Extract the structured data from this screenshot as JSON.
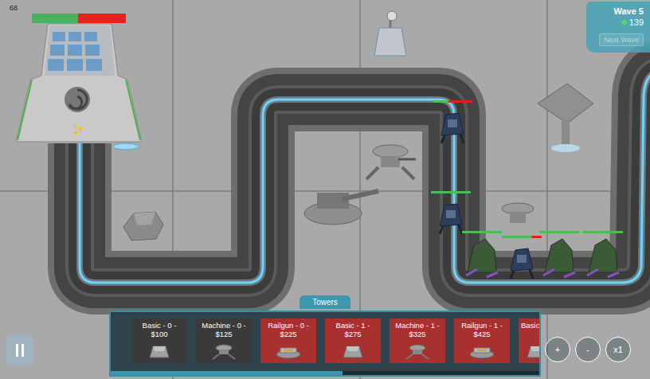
{
  "fps": "68",
  "base": {
    "health": 0.49
  },
  "wave_panel": {
    "wave": "Wave 5",
    "money": "139",
    "next_wave_button": {
      "label": "Next Wave",
      "disabled": true
    }
  },
  "enemies": [
    {
      "kind": "drone",
      "health": 0.4
    },
    {
      "kind": "drone",
      "health": 1.0
    },
    {
      "kind": "brute",
      "health": 1.0
    },
    {
      "kind": "drone",
      "health": 0.75
    },
    {
      "kind": "brute",
      "health": 1.0
    },
    {
      "kind": "brute",
      "health": 1.0
    }
  ],
  "tower_tray": {
    "tab": "Towers",
    "towers": [
      {
        "label": "Basic - 0 - $100",
        "kind": "basic",
        "affordable": true
      },
      {
        "label": "Machine - 0 - $125",
        "kind": "machine",
        "affordable": true
      },
      {
        "label": "Railgun - 0 - $225",
        "kind": "railgun",
        "affordable": false
      },
      {
        "label": "Basic - 1 - $275",
        "kind": "basic",
        "affordable": false
      },
      {
        "label": "Machine - 1 - $325",
        "kind": "machine",
        "affordable": false
      },
      {
        "label": "Railgun - 1 - $425",
        "kind": "railgun",
        "affordable": false
      },
      {
        "label": "Basic",
        "kind": "basic",
        "affordable": false
      }
    ],
    "scroll_level": 0.54
  },
  "speed_controls": [
    "+",
    "-",
    "x1"
  ]
}
